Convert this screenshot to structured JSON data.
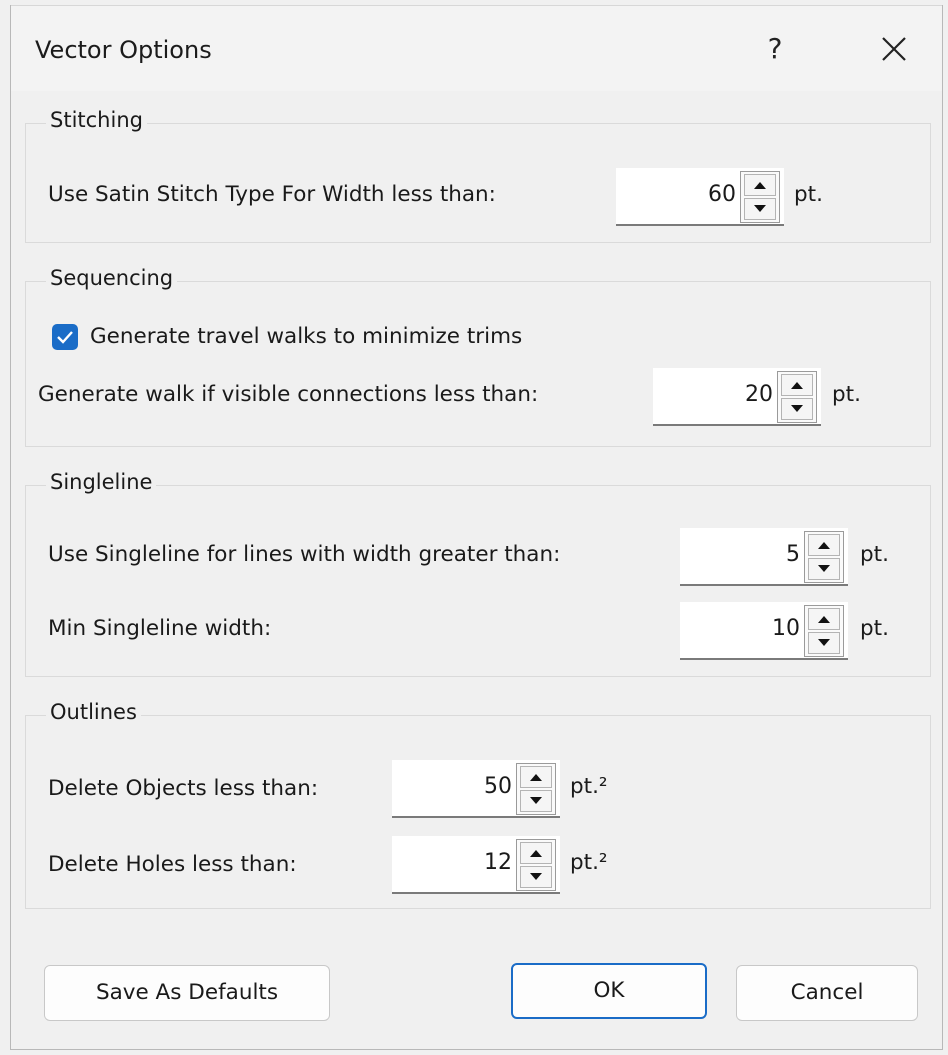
{
  "window": {
    "title": "Vector Options",
    "help_label": "?"
  },
  "stitching": {
    "legend": "Stitching",
    "satin_label": "Use Satin Stitch Type For Width less than:",
    "satin_value": "60",
    "satin_unit": "pt."
  },
  "sequencing": {
    "legend": "Sequencing",
    "travel_walks_label": "Generate travel walks to minimize trims",
    "travel_walks_checked": true,
    "walk_label": "Generate walk if visible connections less than:",
    "walk_value": "20",
    "walk_unit": "pt."
  },
  "singleline": {
    "legend": "Singleline",
    "use_label": "Use Singleline for lines with width greater than:",
    "use_value": "5",
    "use_unit": "pt.",
    "min_label": "Min Singleline width:",
    "min_value": "10",
    "min_unit": "pt."
  },
  "outlines": {
    "legend": "Outlines",
    "objects_label": "Delete Objects less than:",
    "objects_value": "50",
    "objects_unit": "pt.²",
    "holes_label": "Delete Holes less than:",
    "holes_value": "12",
    "holes_unit": "pt.²"
  },
  "footer": {
    "save_defaults_label": "Save As Defaults",
    "ok_label": "OK",
    "cancel_label": "Cancel"
  },
  "colors": {
    "accent": "#1a6cc7",
    "background": "#f0f0f0"
  }
}
